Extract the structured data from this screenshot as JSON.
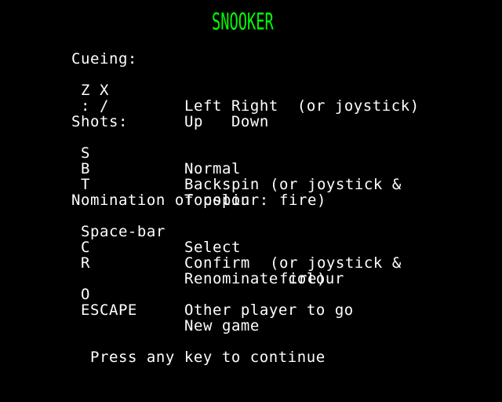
{
  "title": "SNOOKER",
  "colors": {
    "background": "#000000",
    "title": "#00ff00",
    "text": "#ffffff"
  },
  "sections": {
    "cueing": {
      "heading": "Cueing:",
      "rows": [
        {
          "key": " Z X",
          "action": "Left Right",
          "note": "  (or joystick)"
        },
        {
          "key": " : /",
          "action": "Up   Down",
          "note": ""
        }
      ]
    },
    "shots": {
      "heading": "Shots:",
      "rows": [
        {
          "key": " S",
          "action": "Normal",
          "note": "(or joystick &"
        },
        {
          "key": " B",
          "action": "Backspin",
          "note": " fire)"
        },
        {
          "key": " T",
          "action": "Topspin",
          "note": ""
        }
      ]
    },
    "nomination": {
      "heading": "Nomination of colour:",
      "rows": [
        {
          "key": " Space-bar",
          "action": "Select",
          "note": "(or joystick &"
        },
        {
          "key": " C",
          "action": "Confirm",
          "note": " fire)"
        },
        {
          "key": " R",
          "action": "Renominate colour",
          "note": ""
        }
      ]
    },
    "other": {
      "rows": [
        {
          "key": " O",
          "action": "Other player to go",
          "note": ""
        },
        {
          "key": " ESCAPE",
          "action": "New game",
          "note": ""
        }
      ]
    }
  },
  "prompt": "Press any key to continue"
}
